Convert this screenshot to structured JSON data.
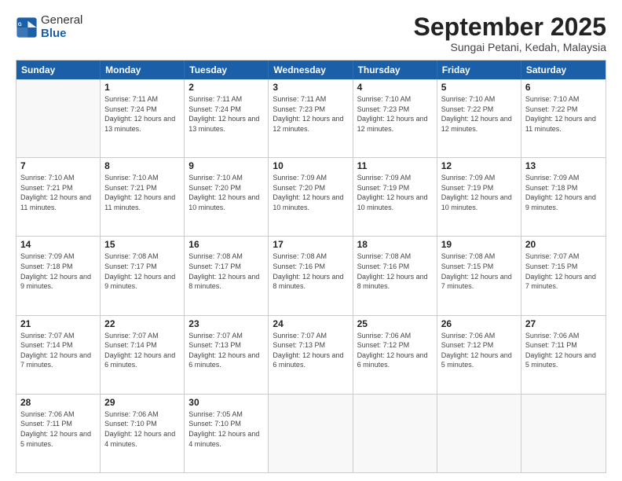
{
  "header": {
    "logo": {
      "line1": "General",
      "line2": "Blue"
    },
    "title": "September 2025",
    "location": "Sungai Petani, Kedah, Malaysia"
  },
  "weekdays": [
    "Sunday",
    "Monday",
    "Tuesday",
    "Wednesday",
    "Thursday",
    "Friday",
    "Saturday"
  ],
  "rows": [
    [
      {
        "day": "",
        "sunrise": "",
        "sunset": "",
        "daylight": ""
      },
      {
        "day": "1",
        "sunrise": "Sunrise: 7:11 AM",
        "sunset": "Sunset: 7:24 PM",
        "daylight": "Daylight: 12 hours and 13 minutes."
      },
      {
        "day": "2",
        "sunrise": "Sunrise: 7:11 AM",
        "sunset": "Sunset: 7:24 PM",
        "daylight": "Daylight: 12 hours and 13 minutes."
      },
      {
        "day": "3",
        "sunrise": "Sunrise: 7:11 AM",
        "sunset": "Sunset: 7:23 PM",
        "daylight": "Daylight: 12 hours and 12 minutes."
      },
      {
        "day": "4",
        "sunrise": "Sunrise: 7:10 AM",
        "sunset": "Sunset: 7:23 PM",
        "daylight": "Daylight: 12 hours and 12 minutes."
      },
      {
        "day": "5",
        "sunrise": "Sunrise: 7:10 AM",
        "sunset": "Sunset: 7:22 PM",
        "daylight": "Daylight: 12 hours and 12 minutes."
      },
      {
        "day": "6",
        "sunrise": "Sunrise: 7:10 AM",
        "sunset": "Sunset: 7:22 PM",
        "daylight": "Daylight: 12 hours and 11 minutes."
      }
    ],
    [
      {
        "day": "7",
        "sunrise": "Sunrise: 7:10 AM",
        "sunset": "Sunset: 7:21 PM",
        "daylight": "Daylight: 12 hours and 11 minutes."
      },
      {
        "day": "8",
        "sunrise": "Sunrise: 7:10 AM",
        "sunset": "Sunset: 7:21 PM",
        "daylight": "Daylight: 12 hours and 11 minutes."
      },
      {
        "day": "9",
        "sunrise": "Sunrise: 7:10 AM",
        "sunset": "Sunset: 7:20 PM",
        "daylight": "Daylight: 12 hours and 10 minutes."
      },
      {
        "day": "10",
        "sunrise": "Sunrise: 7:09 AM",
        "sunset": "Sunset: 7:20 PM",
        "daylight": "Daylight: 12 hours and 10 minutes."
      },
      {
        "day": "11",
        "sunrise": "Sunrise: 7:09 AM",
        "sunset": "Sunset: 7:19 PM",
        "daylight": "Daylight: 12 hours and 10 minutes."
      },
      {
        "day": "12",
        "sunrise": "Sunrise: 7:09 AM",
        "sunset": "Sunset: 7:19 PM",
        "daylight": "Daylight: 12 hours and 10 minutes."
      },
      {
        "day": "13",
        "sunrise": "Sunrise: 7:09 AM",
        "sunset": "Sunset: 7:18 PM",
        "daylight": "Daylight: 12 hours and 9 minutes."
      }
    ],
    [
      {
        "day": "14",
        "sunrise": "Sunrise: 7:09 AM",
        "sunset": "Sunset: 7:18 PM",
        "daylight": "Daylight: 12 hours and 9 minutes."
      },
      {
        "day": "15",
        "sunrise": "Sunrise: 7:08 AM",
        "sunset": "Sunset: 7:17 PM",
        "daylight": "Daylight: 12 hours and 9 minutes."
      },
      {
        "day": "16",
        "sunrise": "Sunrise: 7:08 AM",
        "sunset": "Sunset: 7:17 PM",
        "daylight": "Daylight: 12 hours and 8 minutes."
      },
      {
        "day": "17",
        "sunrise": "Sunrise: 7:08 AM",
        "sunset": "Sunset: 7:16 PM",
        "daylight": "Daylight: 12 hours and 8 minutes."
      },
      {
        "day": "18",
        "sunrise": "Sunrise: 7:08 AM",
        "sunset": "Sunset: 7:16 PM",
        "daylight": "Daylight: 12 hours and 8 minutes."
      },
      {
        "day": "19",
        "sunrise": "Sunrise: 7:08 AM",
        "sunset": "Sunset: 7:15 PM",
        "daylight": "Daylight: 12 hours and 7 minutes."
      },
      {
        "day": "20",
        "sunrise": "Sunrise: 7:07 AM",
        "sunset": "Sunset: 7:15 PM",
        "daylight": "Daylight: 12 hours and 7 minutes."
      }
    ],
    [
      {
        "day": "21",
        "sunrise": "Sunrise: 7:07 AM",
        "sunset": "Sunset: 7:14 PM",
        "daylight": "Daylight: 12 hours and 7 minutes."
      },
      {
        "day": "22",
        "sunrise": "Sunrise: 7:07 AM",
        "sunset": "Sunset: 7:14 PM",
        "daylight": "Daylight: 12 hours and 6 minutes."
      },
      {
        "day": "23",
        "sunrise": "Sunrise: 7:07 AM",
        "sunset": "Sunset: 7:13 PM",
        "daylight": "Daylight: 12 hours and 6 minutes."
      },
      {
        "day": "24",
        "sunrise": "Sunrise: 7:07 AM",
        "sunset": "Sunset: 7:13 PM",
        "daylight": "Daylight: 12 hours and 6 minutes."
      },
      {
        "day": "25",
        "sunrise": "Sunrise: 7:06 AM",
        "sunset": "Sunset: 7:12 PM",
        "daylight": "Daylight: 12 hours and 6 minutes."
      },
      {
        "day": "26",
        "sunrise": "Sunrise: 7:06 AM",
        "sunset": "Sunset: 7:12 PM",
        "daylight": "Daylight: 12 hours and 5 minutes."
      },
      {
        "day": "27",
        "sunrise": "Sunrise: 7:06 AM",
        "sunset": "Sunset: 7:11 PM",
        "daylight": "Daylight: 12 hours and 5 minutes."
      }
    ],
    [
      {
        "day": "28",
        "sunrise": "Sunrise: 7:06 AM",
        "sunset": "Sunset: 7:11 PM",
        "daylight": "Daylight: 12 hours and 5 minutes."
      },
      {
        "day": "29",
        "sunrise": "Sunrise: 7:06 AM",
        "sunset": "Sunset: 7:10 PM",
        "daylight": "Daylight: 12 hours and 4 minutes."
      },
      {
        "day": "30",
        "sunrise": "Sunrise: 7:05 AM",
        "sunset": "Sunset: 7:10 PM",
        "daylight": "Daylight: 12 hours and 4 minutes."
      },
      {
        "day": "",
        "sunrise": "",
        "sunset": "",
        "daylight": ""
      },
      {
        "day": "",
        "sunrise": "",
        "sunset": "",
        "daylight": ""
      },
      {
        "day": "",
        "sunrise": "",
        "sunset": "",
        "daylight": ""
      },
      {
        "day": "",
        "sunrise": "",
        "sunset": "",
        "daylight": ""
      }
    ]
  ]
}
